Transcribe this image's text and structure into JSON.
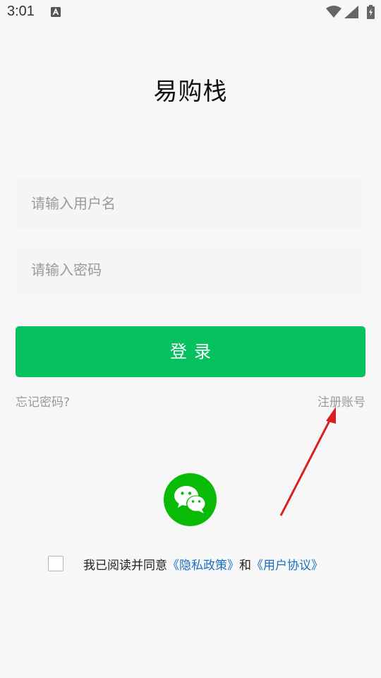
{
  "status_bar": {
    "time": "3:01",
    "icons": [
      "text-a-icon",
      "wifi-icon",
      "signal-icon",
      "battery-icon"
    ]
  },
  "app": {
    "title": "易购栈"
  },
  "form": {
    "username_placeholder": "请输入用户名",
    "username_value": "",
    "password_placeholder": "请输入密码",
    "password_value": "",
    "login_label": "登录",
    "forgot_password": "忘记密码?",
    "register": "注册账号"
  },
  "social_login": {
    "icon": "wechat-icon"
  },
  "agreement": {
    "checked": false,
    "prefix": "我已阅读并同意",
    "privacy_policy": "《隐私政策》",
    "and": "和",
    "user_agreement": "《用户协议》"
  },
  "colors": {
    "primary": "#07c160",
    "wechat": "#09bb07",
    "link": "#1a6fc4",
    "annotation_arrow": "#d81e1e"
  }
}
